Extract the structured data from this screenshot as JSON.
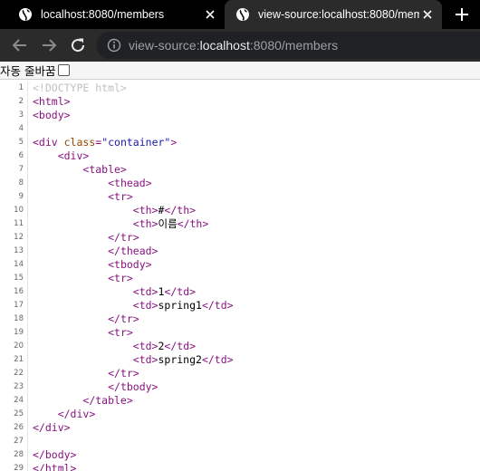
{
  "tabs": [
    {
      "title": "localhost:8080/members"
    },
    {
      "title": "view-source:localhost:8080/members"
    }
  ],
  "toolbar": {
    "url_prefix": "view-source:",
    "url_host": "localhost",
    "url_rest": ":8080/members"
  },
  "wrapbar": {
    "label": "자동 줄바꿈",
    "checked": false
  },
  "source": {
    "lines": [
      {
        "n": "1",
        "indent": "",
        "parts": [
          [
            "cm",
            "<!DOCTYPE html>"
          ]
        ]
      },
      {
        "n": "2",
        "indent": "",
        "parts": [
          [
            "c",
            "<html>"
          ]
        ]
      },
      {
        "n": "3",
        "indent": "",
        "parts": [
          [
            "c",
            "<body>"
          ]
        ]
      },
      {
        "n": "4",
        "indent": "",
        "parts": []
      },
      {
        "n": "5",
        "indent": "",
        "parts": [
          [
            "c",
            "<div "
          ],
          [
            "a",
            "class"
          ],
          [
            "c",
            "="
          ],
          [
            "v",
            "\"container\""
          ],
          [
            "c",
            ">"
          ]
        ]
      },
      {
        "n": "6",
        "indent": "    ",
        "parts": [
          [
            "c",
            "<div>"
          ]
        ]
      },
      {
        "n": "7",
        "indent": "        ",
        "parts": [
          [
            "c",
            "<table>"
          ]
        ]
      },
      {
        "n": "8",
        "indent": "            ",
        "parts": [
          [
            "c",
            "<thead>"
          ]
        ]
      },
      {
        "n": "9",
        "indent": "            ",
        "parts": [
          [
            "c",
            "<tr>"
          ]
        ]
      },
      {
        "n": "10",
        "indent": "                ",
        "parts": [
          [
            "c",
            "<th>"
          ],
          [
            "t",
            "#"
          ],
          [
            "c",
            "</th>"
          ]
        ]
      },
      {
        "n": "11",
        "indent": "                ",
        "parts": [
          [
            "c",
            "<th>"
          ],
          [
            "t",
            "이름"
          ],
          [
            "c",
            "</th>"
          ]
        ]
      },
      {
        "n": "12",
        "indent": "            ",
        "parts": [
          [
            "c",
            "</tr>"
          ]
        ]
      },
      {
        "n": "13",
        "indent": "            ",
        "parts": [
          [
            "c",
            "</thead>"
          ]
        ]
      },
      {
        "n": "14",
        "indent": "            ",
        "parts": [
          [
            "c",
            "<tbody>"
          ]
        ]
      },
      {
        "n": "15",
        "indent": "            ",
        "parts": [
          [
            "c",
            "<tr>"
          ]
        ]
      },
      {
        "n": "16",
        "indent": "                ",
        "parts": [
          [
            "c",
            "<td>"
          ],
          [
            "t",
            "1"
          ],
          [
            "c",
            "</td>"
          ]
        ]
      },
      {
        "n": "17",
        "indent": "                ",
        "parts": [
          [
            "c",
            "<td>"
          ],
          [
            "t",
            "spring1"
          ],
          [
            "c",
            "</td>"
          ]
        ]
      },
      {
        "n": "18",
        "indent": "            ",
        "parts": [
          [
            "c",
            "</tr>"
          ]
        ]
      },
      {
        "n": "19",
        "indent": "            ",
        "parts": [
          [
            "c",
            "<tr>"
          ]
        ]
      },
      {
        "n": "20",
        "indent": "                ",
        "parts": [
          [
            "c",
            "<td>"
          ],
          [
            "t",
            "2"
          ],
          [
            "c",
            "</td>"
          ]
        ]
      },
      {
        "n": "21",
        "indent": "                ",
        "parts": [
          [
            "c",
            "<td>"
          ],
          [
            "t",
            "spring2"
          ],
          [
            "c",
            "</td>"
          ]
        ]
      },
      {
        "n": "22",
        "indent": "            ",
        "parts": [
          [
            "c",
            "</tr>"
          ]
        ]
      },
      {
        "n": "23",
        "indent": "            ",
        "parts": [
          [
            "c",
            "</tbody>"
          ]
        ]
      },
      {
        "n": "24",
        "indent": "        ",
        "parts": [
          [
            "c",
            "</table>"
          ]
        ]
      },
      {
        "n": "25",
        "indent": "    ",
        "parts": [
          [
            "c",
            "</div>"
          ]
        ]
      },
      {
        "n": "26",
        "indent": "",
        "parts": [
          [
            "c",
            "</div>"
          ]
        ]
      },
      {
        "n": "27",
        "indent": "",
        "parts": []
      },
      {
        "n": "28",
        "indent": "",
        "parts": [
          [
            "c",
            "</body>"
          ]
        ]
      },
      {
        "n": "29",
        "indent": "",
        "parts": [
          [
            "c",
            "</html>"
          ]
        ]
      }
    ]
  },
  "colors": {
    "tag": "#881280",
    "attr": "#994500",
    "value": "#1a1aa6",
    "comment": "#c0c0c0",
    "line_number": "#666666"
  }
}
